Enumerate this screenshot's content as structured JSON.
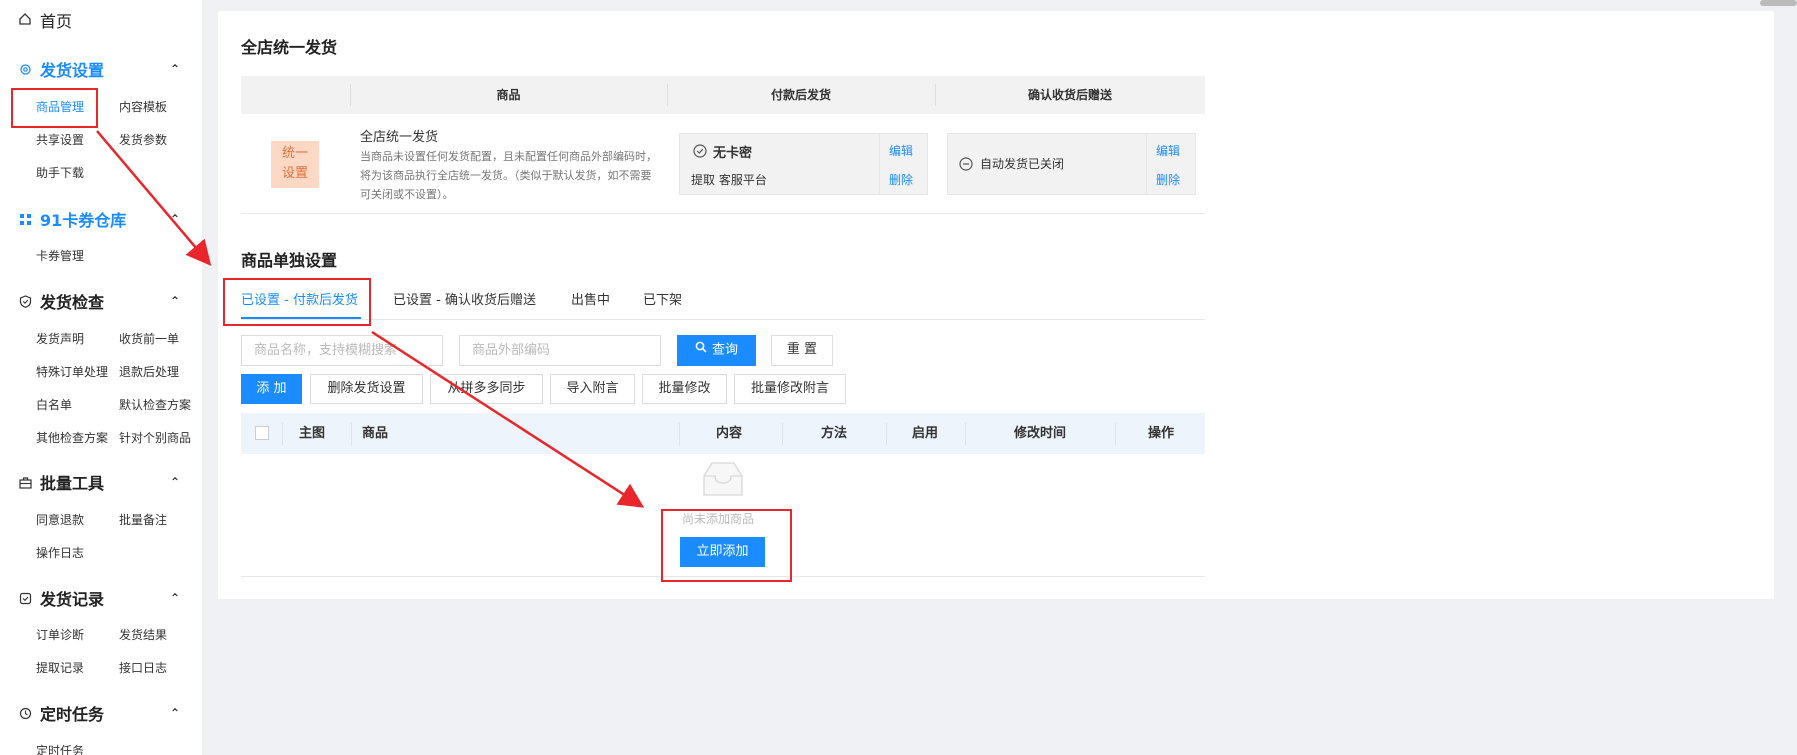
{
  "sidebar": {
    "home": "首页",
    "groups": [
      {
        "title": "发货设置",
        "items": [
          "商品管理",
          "内容模板",
          "共享设置",
          "发货参数",
          "助手下载"
        ]
      },
      {
        "title": "91卡券仓库",
        "items": [
          "卡券管理"
        ]
      },
      {
        "title": "发货检查",
        "items": [
          "发货声明",
          "收货前一单",
          "特殊订单处理",
          "退款后处理",
          "白名单",
          "默认检查方案",
          "其他检查方案",
          "针对个别商品"
        ]
      },
      {
        "title": "批量工具",
        "items": [
          "同意退款",
          "批量备注",
          "操作日志"
        ]
      },
      {
        "title": "发货记录",
        "items": [
          "订单诊断",
          "发货结果",
          "提取记录",
          "接口日志"
        ]
      },
      {
        "title": "定时任务",
        "items": [
          "定时任务"
        ]
      }
    ],
    "caret": "^"
  },
  "store": {
    "title": "全店统一发货",
    "columns": [
      "商品",
      "付款后发货",
      "确认收货后赠送"
    ],
    "badge_line1": "统一",
    "badge_line2": "设置",
    "row_title": "全店统一发货",
    "row_desc": "当商品未设置任何发货配置，且未配置任何商品外部编码时，将为该商品执行全店统一发货。（类似于默认发货，如不需要可关闭或不设置）。",
    "pay_status": "无卡密",
    "pay_sub": "提取  客服平台",
    "gift_status": "自动发货已关闭",
    "edit": "编辑",
    "delete": "删除"
  },
  "single": {
    "title": "商品单独设置",
    "tabs": [
      "已设置 - 付款后发货",
      "已设置 - 确认收货后赠送",
      "出售中",
      "已下架"
    ],
    "search_placeholder": "商品名称，支持模糊搜索",
    "code_placeholder": "商品外部编码",
    "query": "查询",
    "reset": "重 置",
    "actions": [
      "添 加",
      "删除发货设置",
      "从拼多多同步",
      "导入附言",
      "批量修改",
      "批量修改附言"
    ],
    "columns": [
      "主图",
      "商品",
      "内容",
      "方法",
      "启用",
      "修改时间",
      "操作"
    ],
    "empty": "尚未添加商品",
    "add_now": "立即添加"
  },
  "colors": {
    "accent": "#1a8cff",
    "annotation": "#e8262b"
  }
}
